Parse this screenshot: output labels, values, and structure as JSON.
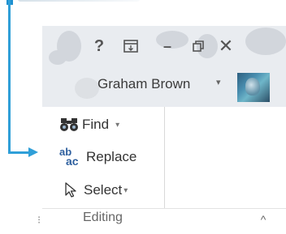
{
  "window": {
    "help_label": "?",
    "ribbon_options_icon": "ribbon-display-icon",
    "minimize_label": "–",
    "restore_label": "🗗",
    "close_label": "✕",
    "user_name": "Graham Brown",
    "user_caret": "▾",
    "avatar_icon": "user-avatar"
  },
  "editing_group": {
    "label": "Editing",
    "commands": [
      {
        "label": "Find",
        "icon": "binoculars-icon",
        "has_dropdown": true
      },
      {
        "label": "Replace",
        "icon": "replace-icon"
      },
      {
        "label": "Select",
        "icon": "cursor-arrow-icon",
        "has_dropdown": true
      }
    ],
    "dropdown_caret": "▾",
    "replace_icon_top": "ab",
    "replace_icon_bottom": "ac",
    "launcher_glyph": "⁝",
    "collapse_glyph": "^"
  },
  "colors": {
    "callout": "#2f9fd8",
    "titlebar_bg": "#e9ecf0",
    "text": "#333333"
  }
}
